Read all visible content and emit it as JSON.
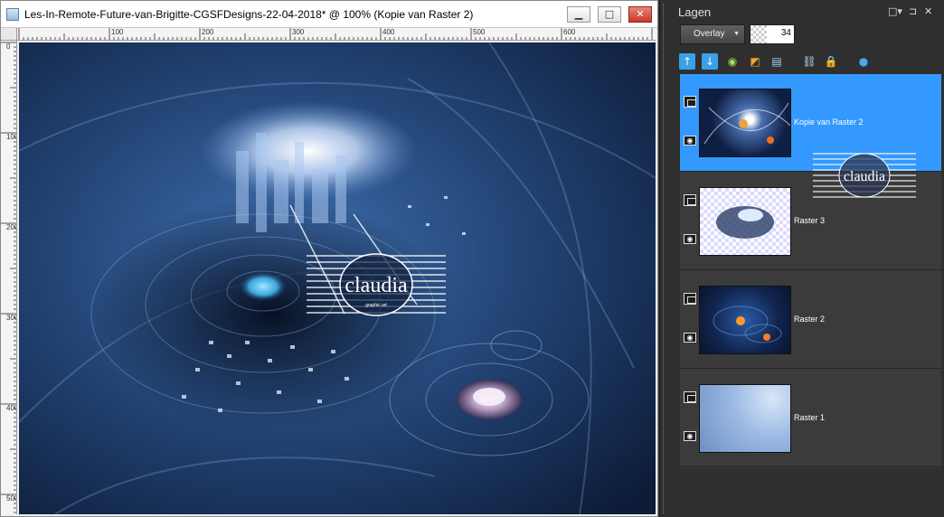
{
  "window": {
    "title": "Les-In-Remote-Future-van-Brigitte-CGSFDesigns-22-04-2018* @ 100% (Kopie van Raster 2)"
  },
  "ruler": {
    "h_labels": [
      "100",
      "200",
      "300",
      "400",
      "500",
      "600"
    ],
    "v_labels": [
      "0",
      "100",
      "200",
      "300",
      "400",
      "500"
    ]
  },
  "watermark": {
    "text": "claudia",
    "sub": "graphic art"
  },
  "layers_panel": {
    "title": "Lagen",
    "blend_mode": "Overlay",
    "opacity": "34",
    "layers": [
      {
        "name": "Kopie van Raster 2",
        "selected": true
      },
      {
        "name": "Raster 3",
        "selected": false
      },
      {
        "name": "Raster 2",
        "selected": false
      },
      {
        "name": "Raster 1",
        "selected": false
      }
    ]
  },
  "colors": {
    "selection": "#3399ff",
    "panel_bg": "#3b3b3b",
    "close_btn": "#c8372b"
  }
}
